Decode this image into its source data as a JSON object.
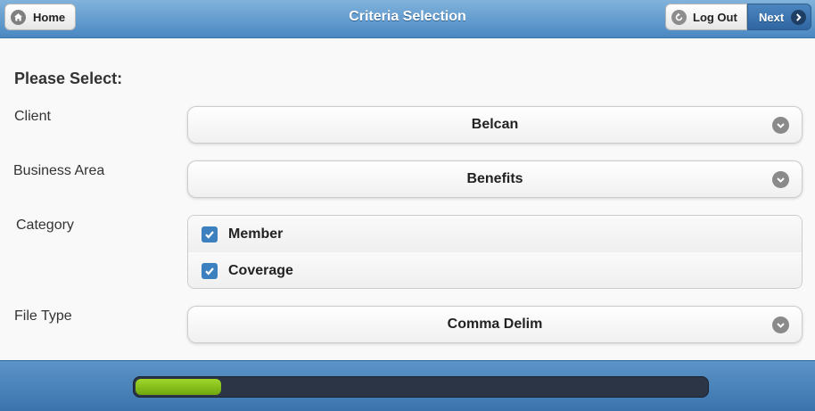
{
  "header": {
    "title": "Criteria Selection",
    "home_label": "Home",
    "logout_label": "Log Out",
    "next_label": "Next"
  },
  "form": {
    "heading": "Please Select:",
    "client": {
      "label": "Client",
      "value": "Belcan"
    },
    "business_area": {
      "label": "Business Area",
      "value": "Benefits"
    },
    "category": {
      "label": "Category",
      "options": [
        {
          "label": "Member",
          "checked": true
        },
        {
          "label": "Coverage",
          "checked": true
        }
      ]
    },
    "file_type": {
      "label": "File Type",
      "value": "Comma Delim"
    }
  },
  "footer": {
    "progress_percent": 15
  },
  "icons": {
    "home": "home-icon",
    "logout": "logout-icon",
    "next": "chevron-right-icon",
    "dropdown": "chevron-down-icon",
    "checkbox": "check-icon"
  },
  "colors": {
    "header": "#4a88c2",
    "next_button": "#2f66a1",
    "checkbox": "#3d80c0",
    "progress_fill": "#8cc21f",
    "progress_track": "#2b3546"
  }
}
